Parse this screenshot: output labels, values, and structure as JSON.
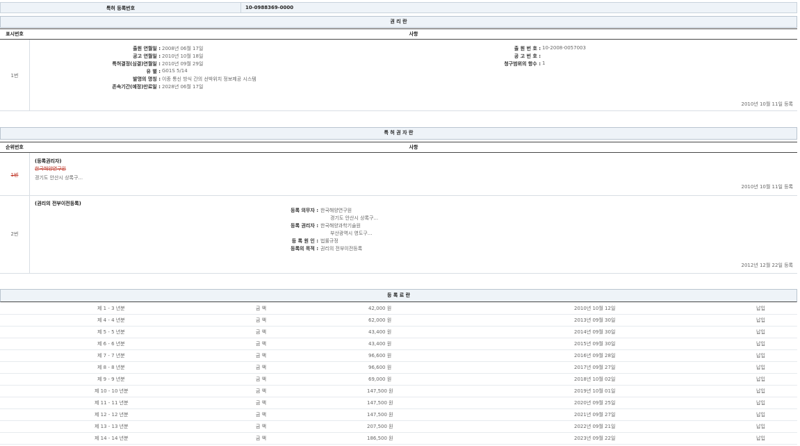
{
  "reg": {
    "label": "특허 등록번호",
    "value": "10-0988369-0000"
  },
  "rights": {
    "title": "권 리 란",
    "col_no": "표시번호",
    "col_content": "사항",
    "row_no": "1번",
    "left_fields": [
      {
        "label": "출원 연월일 :",
        "value": "2008년 06월 17일"
      },
      {
        "label": "공고 연월일 :",
        "value": "2010년 10월 18일"
      },
      {
        "label": "특허결정(심결)연월일 :",
        "value": "2010년 09월 29일"
      },
      {
        "label": "유 별 :",
        "value": "G01S 5/14"
      },
      {
        "label": "발명의 명칭 :",
        "value": "이종 통신 방식 간의 선박위치 정보제공 시스템"
      },
      {
        "label": "존속기간(예정)만료일 :",
        "value": "2028년 06월 17일"
      }
    ],
    "right_fields": [
      {
        "label": "출 원 번 호 :",
        "value": "10-2008-0057003"
      },
      {
        "label": "공 고 번 호 :",
        "value": ""
      },
      {
        "label": "청구범위의 항수 :",
        "value": "1"
      }
    ],
    "reg_date": "2010년 10월 11일 등록"
  },
  "holders": {
    "title": "특 허 권 자 란",
    "col_no": "순위번호",
    "col_content": "사항",
    "entry1": {
      "no": "1번",
      "heading": "(등록권리자)",
      "name": "한국해양연구원",
      "address": "경기도 안산시 상록구...",
      "date": "2010년 10월 11일 등록"
    },
    "entry2": {
      "no": "2번",
      "heading": "(권리의 전부이전등록)",
      "fields": [
        {
          "label": "등록 의무자 :",
          "value": "한국해양연구원"
        },
        {
          "label": "",
          "value": "경기도 안산시 상록구..."
        },
        {
          "label": "등록 권리자 :",
          "value": "한국해양과학기술원"
        },
        {
          "label": "",
          "value": "부산광역시 영도구..."
        },
        {
          "label": "등 록 원 인 :",
          "value": "법률규정"
        },
        {
          "label": "등록의 목적 :",
          "value": "권리의 전부이전등록"
        }
      ],
      "date": "2012년 12월 22일 등록"
    }
  },
  "fees": {
    "title": "등 록 료 란",
    "rows": [
      {
        "period": "제 1 - 3 년분",
        "label": "금 액",
        "amount": "42,000 원",
        "date": "2010년 10월 12일",
        "status": "납입"
      },
      {
        "period": "제 4 - 4 년분",
        "label": "금 액",
        "amount": "62,000 원",
        "date": "2013년 09월 30일",
        "status": "납입"
      },
      {
        "period": "제 5 - 5 년분",
        "label": "금 액",
        "amount": "43,400 원",
        "date": "2014년 09월 30일",
        "status": "납입"
      },
      {
        "period": "제 6 - 6 년분",
        "label": "금 액",
        "amount": "43,400 원",
        "date": "2015년 09월 30일",
        "status": "납입"
      },
      {
        "period": "제 7 - 7 년분",
        "label": "금 액",
        "amount": "96,600 원",
        "date": "2016년 09월 28일",
        "status": "납입"
      },
      {
        "period": "제 8 - 8 년분",
        "label": "금 액",
        "amount": "96,600 원",
        "date": "2017년 09월 27일",
        "status": "납입"
      },
      {
        "period": "제 9 - 9 년분",
        "label": "금 액",
        "amount": "69,000 원",
        "date": "2018년 10월 02일",
        "status": "납입"
      },
      {
        "period": "제 10 - 10 년분",
        "label": "금 액",
        "amount": "147,500 원",
        "date": "2019년 10월 01일",
        "status": "납입"
      },
      {
        "period": "제 11 - 11 년분",
        "label": "금 액",
        "amount": "147,500 원",
        "date": "2020년 09월 25일",
        "status": "납입"
      },
      {
        "period": "제 12 - 12 년분",
        "label": "금 액",
        "amount": "147,500 원",
        "date": "2021년 09월 27일",
        "status": "납입"
      },
      {
        "period": "제 13 - 13 년분",
        "label": "금 액",
        "amount": "207,500 원",
        "date": "2022년 09월 21일",
        "status": "납입"
      },
      {
        "period": "제 14 - 14 년분",
        "label": "금 액",
        "amount": "186,500 원",
        "date": "2023년 09월 22일",
        "status": "납입"
      }
    ]
  }
}
